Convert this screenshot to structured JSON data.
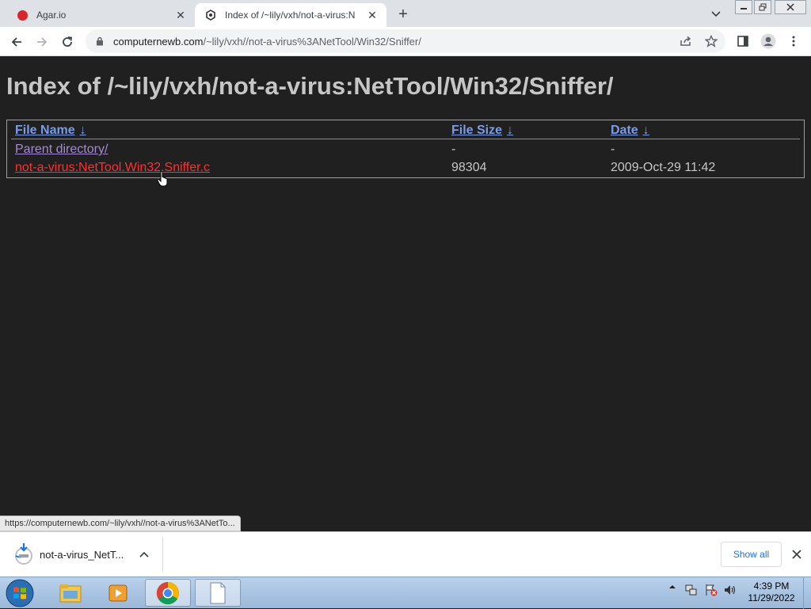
{
  "browser": {
    "tabs": [
      {
        "title": "Agar.io",
        "active": false
      },
      {
        "title": "Index of /~lily/vxh/not-a-virus:N",
        "active": true
      }
    ],
    "address": {
      "host": "computernewb.com",
      "path": "/~lily/vxh//not-a-virus%3ANetTool/Win32/Sniffer/"
    }
  },
  "page": {
    "heading": "Index of /~lily/vxh/not-a-virus:NetTool/Win32/Sniffer/",
    "columns": [
      {
        "label": "File Name",
        "sort": "↓"
      },
      {
        "label": "File Size",
        "sort": "↓"
      },
      {
        "label": "Date",
        "sort": "↓"
      }
    ],
    "rows": [
      {
        "name": "Parent directory/",
        "size": "-",
        "date": "-"
      },
      {
        "name": "not-a-virus:NetTool.Win32.Sniffer.c",
        "size": "98304",
        "date": "2009-Oct-29 11:42"
      }
    ],
    "status_url": "https://computernewb.com/~lily/vxh//not-a-virus%3ANetTo..."
  },
  "downloads": {
    "item_name": "not-a-virus_NetT...",
    "show_all": "Show all"
  },
  "taskbar": {
    "time": "4:39 PM",
    "date": "11/29/2022"
  },
  "colors": {
    "page_bg": "#202020",
    "heading": "#c6c6c6",
    "header_link": "#7a9ce8",
    "visited_link": "#a48ad4",
    "hover_link": "#ff3030"
  }
}
